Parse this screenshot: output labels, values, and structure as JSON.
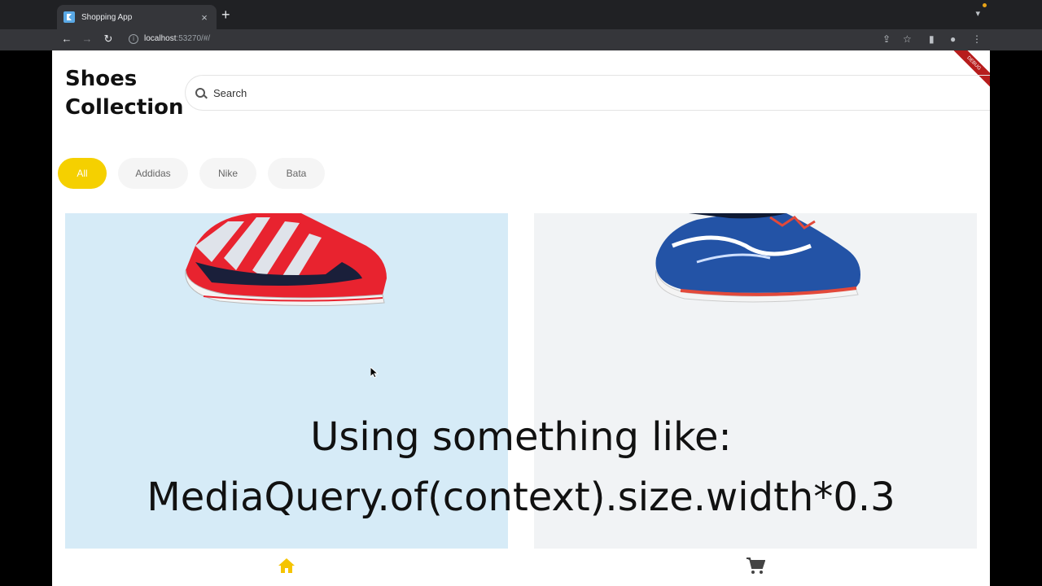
{
  "browser": {
    "tab_title": "Shopping App",
    "tab_close": "×",
    "new_tab": "+",
    "url_host": "localhost",
    "url_rest": ":53270/#/"
  },
  "app": {
    "debug_label": "DEBUG",
    "title": "Shoes Collection",
    "search": {
      "placeholder": "Search",
      "value": ""
    },
    "filters": [
      {
        "label": "All",
        "active": true
      },
      {
        "label": "Addidas",
        "active": false
      },
      {
        "label": "Nike",
        "active": false
      },
      {
        "label": "Bata",
        "active": false
      }
    ],
    "caption_line1": "Using something like:",
    "caption_line2": "MediaQuery.of(context).size.width*0.3"
  },
  "colors": {
    "accent": "#f5d000",
    "card_left_bg": "#d6ebf7",
    "card_right_bg": "#f1f3f5",
    "browser_dark": "#202124"
  },
  "icons": {
    "home": "home-icon",
    "cart": "cart-icon"
  }
}
